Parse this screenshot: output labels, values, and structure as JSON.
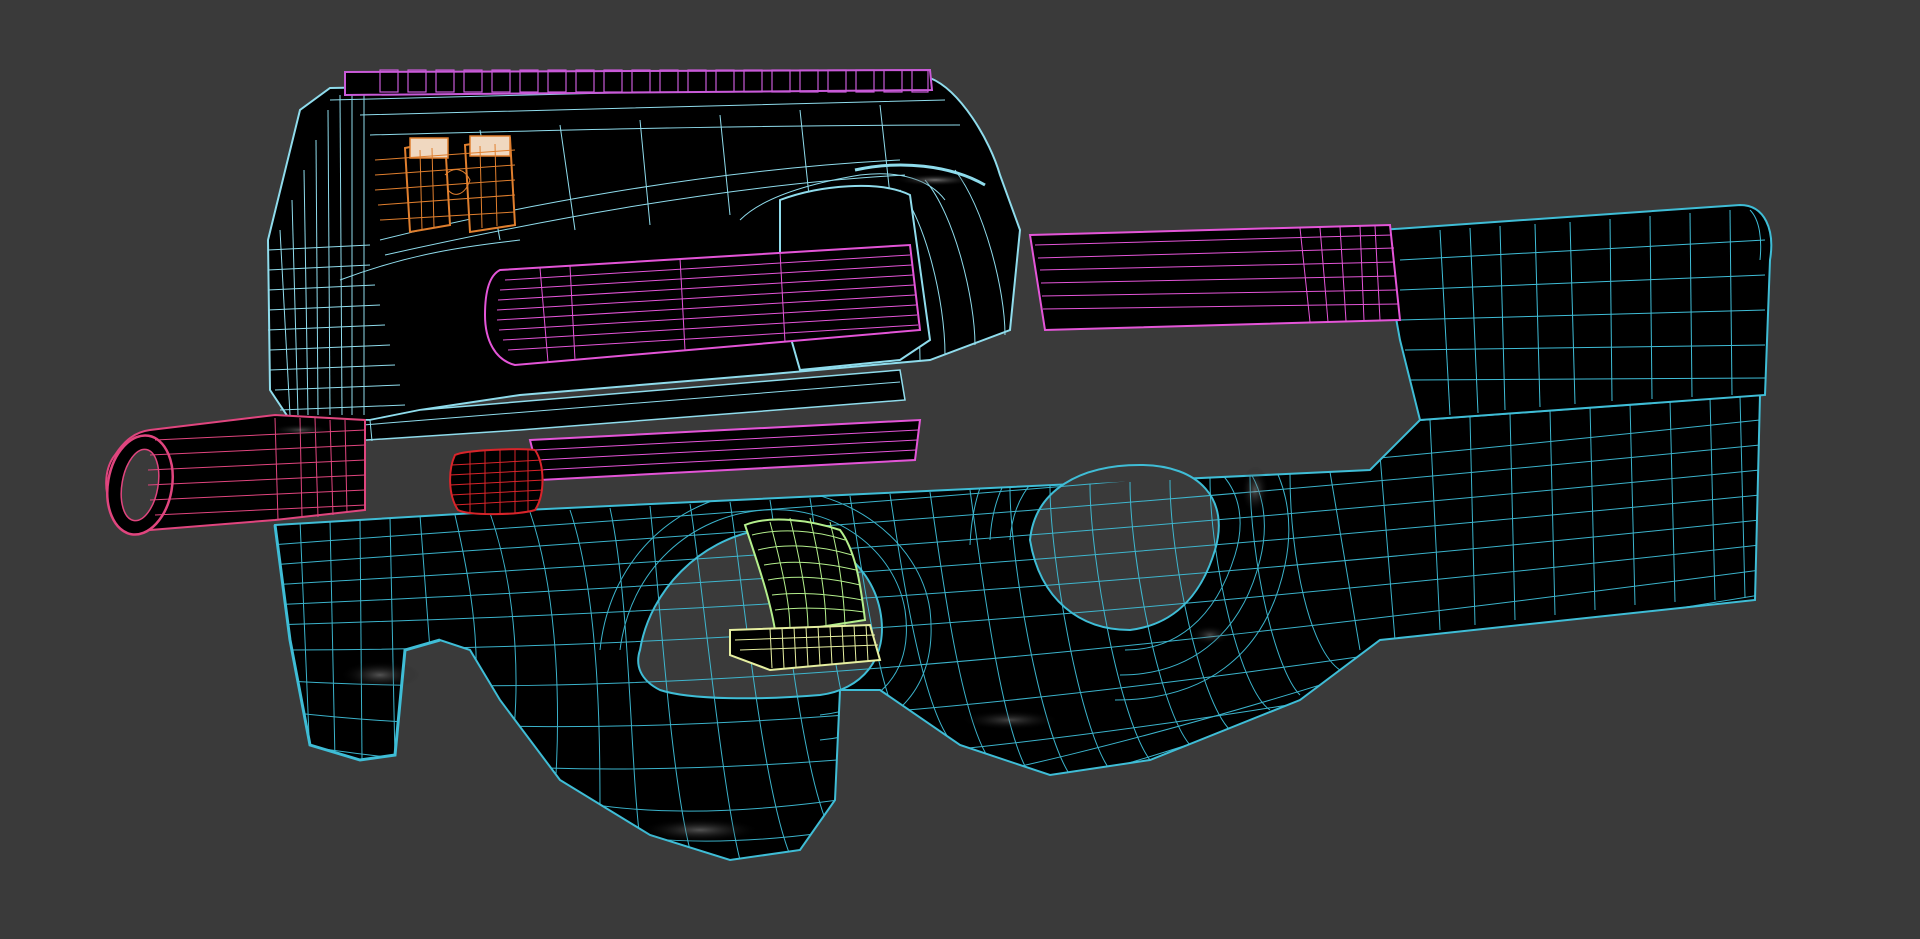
{
  "viewport": {
    "background": "#3a3a3a"
  },
  "model": {
    "colors": {
      "body_wire": "#3fbdd6",
      "receiver_wire": "#8fdcec",
      "magazine_wire": "#e455d8",
      "muzzle_wire": "#e0457e",
      "front_sight_wire": "#e07f2e",
      "bolt_knob_wire": "#d8242a",
      "trigger_wire": "#b4ef8c",
      "trigger_base_wire": "#e6efa0",
      "rail_wire": "#c95ad8",
      "surface": "#000000",
      "highlight": "#8a8a8a"
    },
    "parts": [
      "lower-body",
      "upper-receiver",
      "top-rail",
      "magazine",
      "muzzle",
      "front-sight",
      "charging-knob",
      "trigger",
      "trigger-base",
      "stock"
    ]
  }
}
